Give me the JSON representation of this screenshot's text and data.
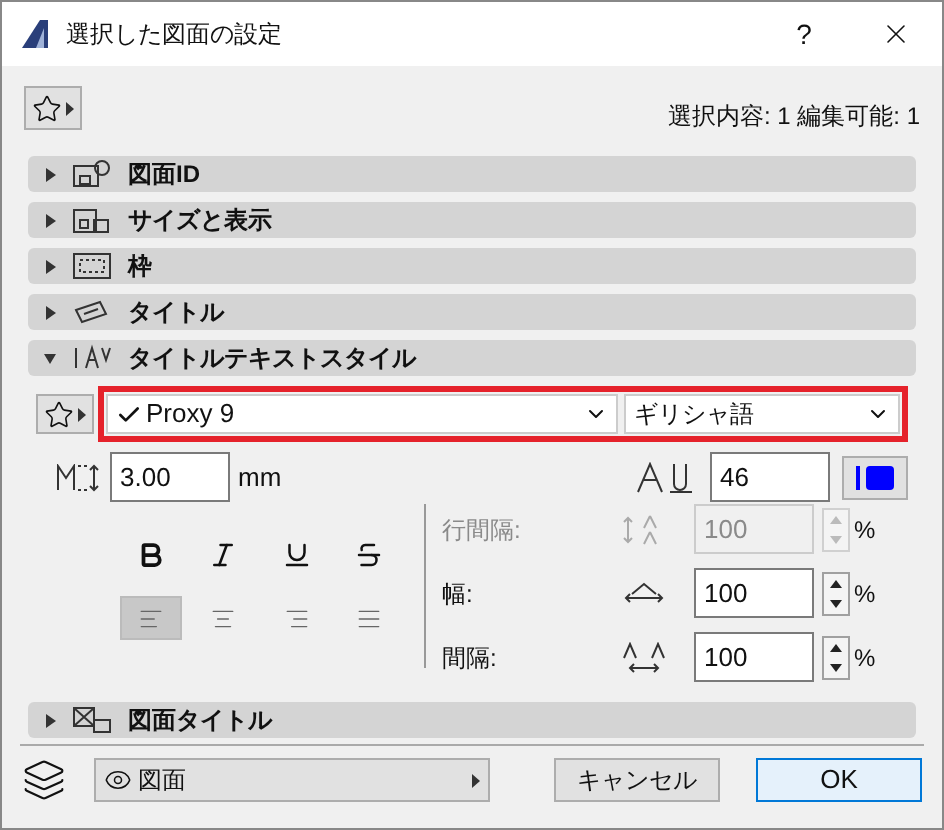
{
  "window": {
    "title": "選択した図面の設定",
    "help": "?"
  },
  "selection_info": "選択内容: 1 編集可能: 1",
  "sections": [
    {
      "label": "図面ID",
      "expanded": false
    },
    {
      "label": "サイズと表示",
      "expanded": false
    },
    {
      "label": "枠",
      "expanded": false
    },
    {
      "label": "タイトル",
      "expanded": false
    },
    {
      "label": "タイトルテキストスタイル",
      "expanded": true
    },
    {
      "label": "図面タイトル",
      "expanded": false
    }
  ],
  "text_style": {
    "font": {
      "value": "Proxy 9",
      "checked": true
    },
    "script": "ギリシャ語",
    "height": {
      "value": "3.00",
      "unit": "mm"
    },
    "pen": "46",
    "styles": [
      {
        "kind": "bold",
        "selected": false
      },
      {
        "kind": "italic",
        "selected": false
      },
      {
        "kind": "underline",
        "selected": false
      },
      {
        "kind": "strike",
        "selected": false
      }
    ],
    "alignment": [
      {
        "kind": "left",
        "selected": true
      },
      {
        "kind": "center",
        "selected": false
      },
      {
        "kind": "right",
        "selected": false
      },
      {
        "kind": "justify",
        "selected": false
      }
    ],
    "spacing": [
      {
        "kind": "line",
        "label": "行間隔:",
        "value": "100",
        "unit": "%",
        "disabled": true
      },
      {
        "kind": "width",
        "label": "幅:",
        "value": "100",
        "unit": "%",
        "disabled": false
      },
      {
        "kind": "gap",
        "label": "間隔:",
        "value": "100",
        "unit": "%",
        "disabled": false
      }
    ]
  },
  "footer": {
    "layer": "図面",
    "cancel": "キャンセル",
    "ok": "OK"
  }
}
